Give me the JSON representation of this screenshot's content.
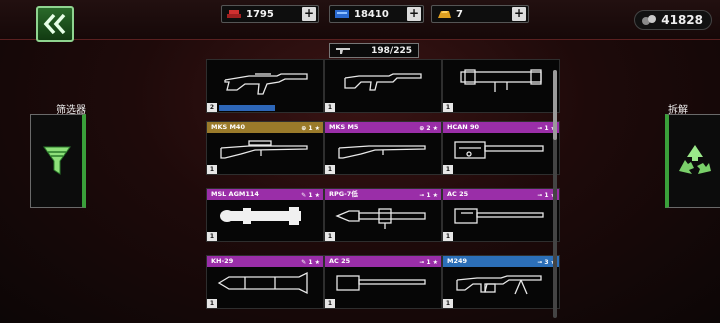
{
  "header": {
    "resources": [
      {
        "name": "armor-plates",
        "value": "1795",
        "icon": "red-plates-icon"
      },
      {
        "name": "blue-crystals",
        "value": "18410",
        "icon": "blue-crystal-icon"
      },
      {
        "name": "gold-bars",
        "value": "7",
        "icon": "gold-bar-icon"
      }
    ],
    "plus_label": "+",
    "coins": "41828"
  },
  "inventory": {
    "count": "198/225"
  },
  "left_panel": {
    "label": "筛选器"
  },
  "right_panel": {
    "label": "拆解"
  },
  "colors": {
    "gold": "#9a7a2a",
    "purple": "#9a2ea8",
    "blue": "#2c6fb8",
    "accent_green": "#3aa03a"
  },
  "cards": [
    {
      "name": "",
      "qty": "2",
      "tags": ""
    },
    {
      "name": "",
      "qty": "1",
      "tags": ""
    },
    {
      "name": "",
      "qty": "1",
      "tags": ""
    },
    {
      "name": "MKS M40",
      "qty": "1",
      "tags": "⊕ 1 ★"
    },
    {
      "name": "MKS M5",
      "qty": "1",
      "tags": "⊕ 2 ★"
    },
    {
      "name": "HCAN 90",
      "qty": "1",
      "tags": "⊸ 1 ★"
    },
    {
      "name": "MSL AGM114",
      "qty": "1",
      "tags": "✎ 1 ★"
    },
    {
      "name": "RPG-7低",
      "qty": "1",
      "tags": "⊸ 1 ★"
    },
    {
      "name": "AC 25",
      "qty": "1",
      "tags": "⊸ 1 ★"
    },
    {
      "name": "KH-29",
      "qty": "1",
      "tags": "✎ 1 ★"
    },
    {
      "name": "AC 25",
      "qty": "1",
      "tags": "⊸ 1 ★"
    },
    {
      "name": "M249",
      "qty": "1",
      "tags": "⊸ 3 ★"
    }
  ]
}
